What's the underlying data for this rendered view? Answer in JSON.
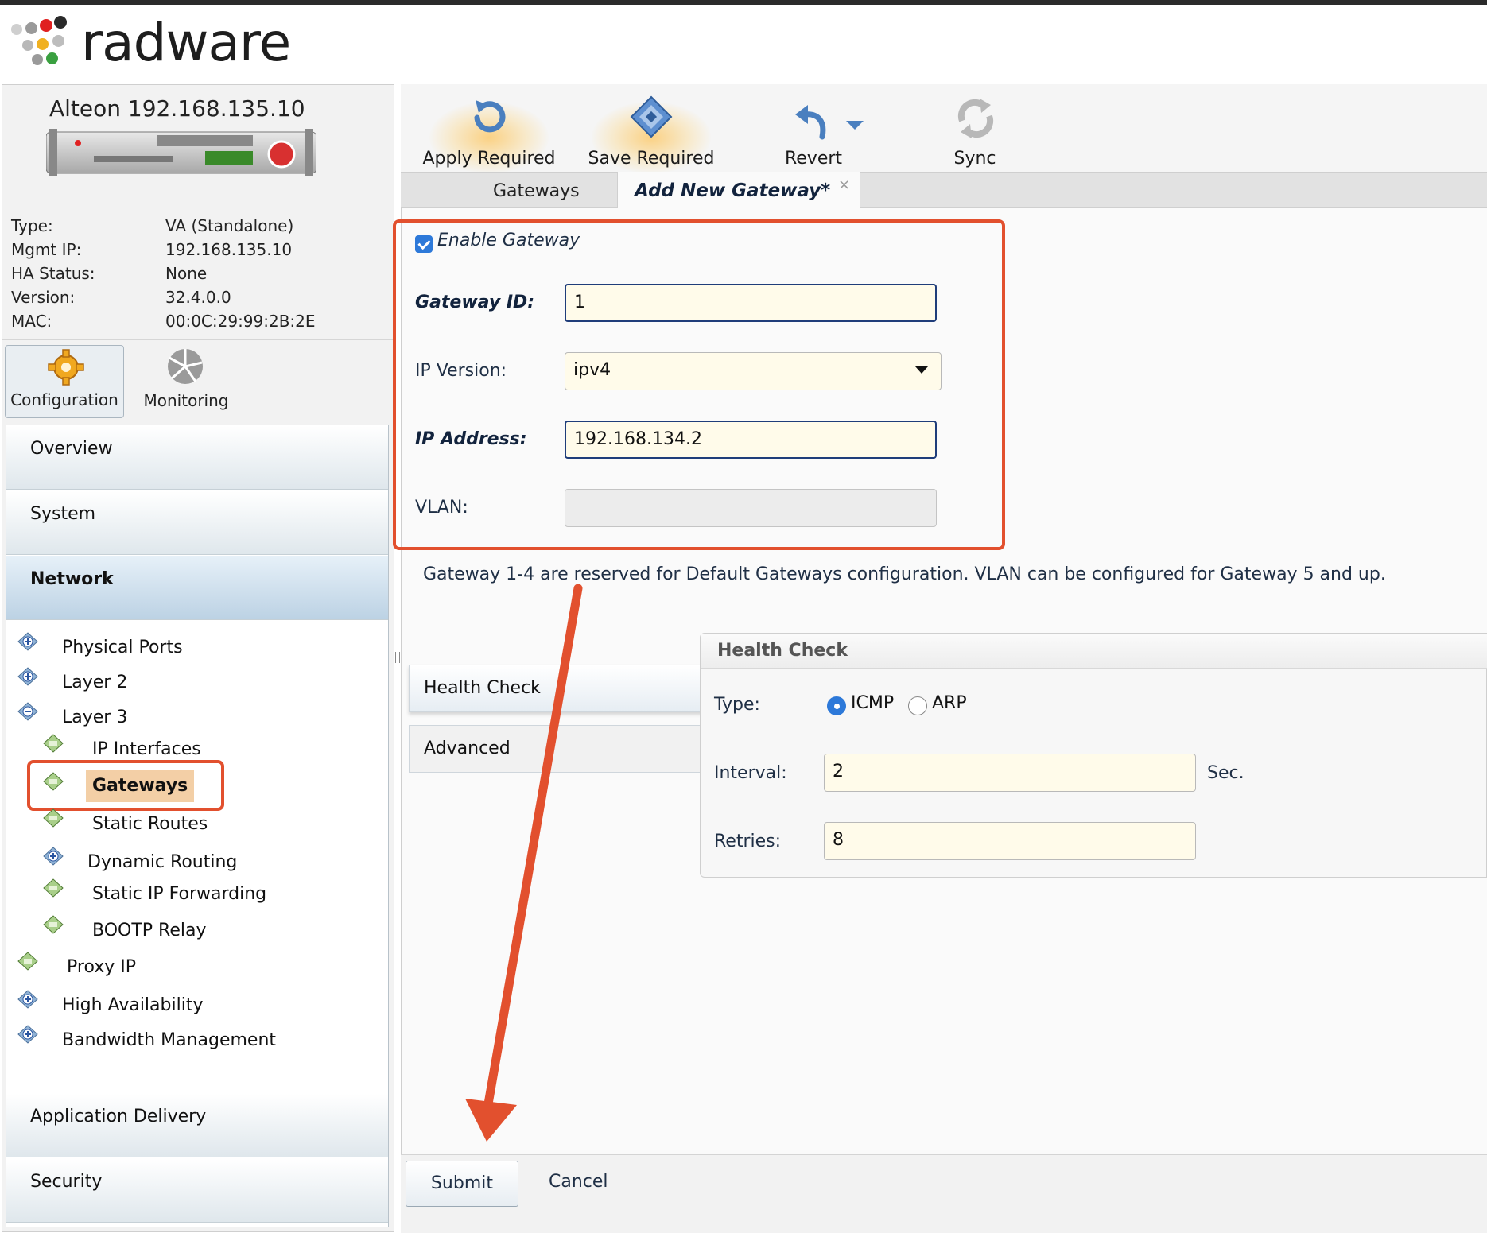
{
  "brand": {
    "logo_text": "radware"
  },
  "device": {
    "title": "Alteon 192.168.135.10",
    "info": [
      {
        "label": "Type:",
        "value": "VA (Standalone)"
      },
      {
        "label": "Mgmt IP:",
        "value": "192.168.135.10"
      },
      {
        "label": "HA Status:",
        "value": "None"
      },
      {
        "label": "Version:",
        "value": "32.4.0.0"
      },
      {
        "label": "MAC:",
        "value": "00:0C:29:99:2B:2E"
      }
    ]
  },
  "mode_tabs": {
    "configuration": "Configuration",
    "monitoring": "Monitoring"
  },
  "nav": {
    "sections": {
      "overview": "Overview",
      "system": "System",
      "network": "Network",
      "application_delivery": "Application Delivery",
      "security": "Security"
    },
    "tree": {
      "physical_ports": "Physical Ports",
      "layer2": "Layer 2",
      "layer3": "Layer 3",
      "ip_interfaces": "IP Interfaces",
      "gateways": "Gateways",
      "static_routes": "Static Routes",
      "dynamic_routing": "Dynamic Routing",
      "static_ip_forwarding": "Static IP Forwarding",
      "bootp_relay": "BOOTP Relay",
      "proxy_ip": "Proxy IP",
      "high_availability": "High Availability",
      "bandwidth_management": "Bandwidth Management"
    }
  },
  "toolbar": {
    "apply": "Apply Required",
    "save": "Save Required",
    "revert": "Revert",
    "sync": "Sync"
  },
  "tabs": {
    "gateways": "Gateways",
    "add_new": "Add New Gateway*",
    "close": "×"
  },
  "form": {
    "enable_label": "Enable Gateway",
    "enable_checked": true,
    "gateway_id_label": "Gateway ID:",
    "gateway_id_value": "1",
    "ip_version_label": "IP Version:",
    "ip_version_value": "ipv4",
    "ip_address_label": "IP Address:",
    "ip_address_value": "192.168.134.2",
    "vlan_label": "VLAN:",
    "vlan_value": ""
  },
  "note": "Gateway 1-4 are reserved for Default Gateways configuration. VLAN can be configured for Gateway 5 and up.",
  "side_tabs": {
    "health_check": "Health Check",
    "advanced": "Advanced"
  },
  "health_check": {
    "title": "Health Check",
    "type_label": "Type:",
    "type_options": [
      "ICMP",
      "ARP"
    ],
    "type_selected": "ICMP",
    "interval_label": "Interval:",
    "interval_value": "2",
    "interval_unit": "Sec.",
    "retries_label": "Retries:",
    "retries_value": "8"
  },
  "actions": {
    "submit": "Submit",
    "cancel": "Cancel"
  },
  "colors": {
    "annotation": "#e2502e",
    "accent": "#2d79d9",
    "input_bg": "#fffbea"
  }
}
